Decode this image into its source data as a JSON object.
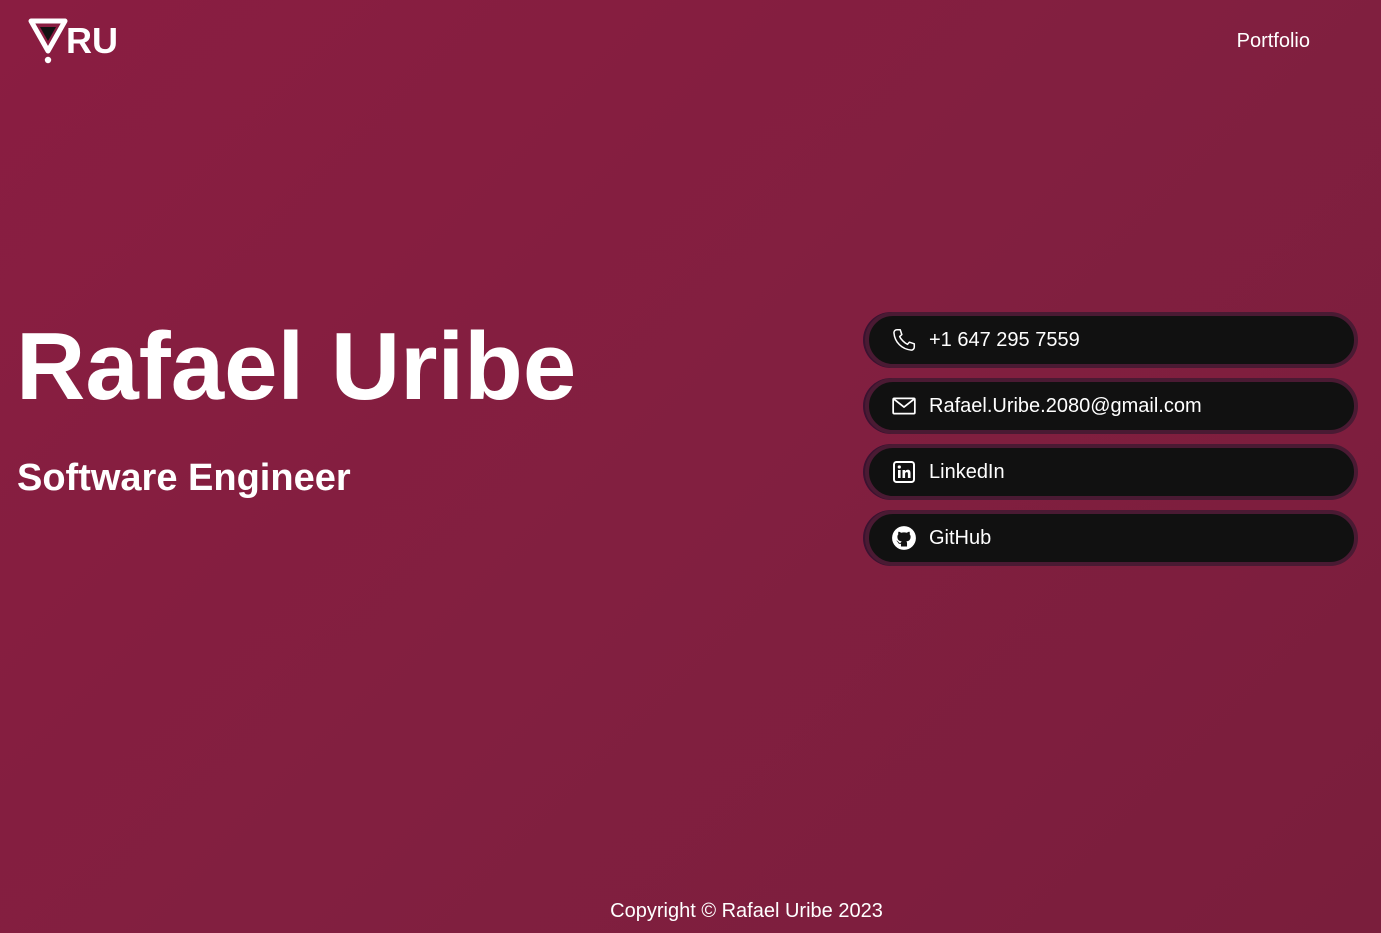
{
  "header": {
    "logo_text": "RU",
    "nav": {
      "portfolio_label": "Portfolio"
    }
  },
  "hero": {
    "name": "Rafael Uribe",
    "role": "Software Engineer"
  },
  "contacts": [
    {
      "label": "+1 647 295 7559",
      "icon": "phone-icon"
    },
    {
      "label": "Rafael.Uribe.2080@gmail.com",
      "icon": "mail-icon"
    },
    {
      "label": "LinkedIn",
      "icon": "linkedin-icon"
    },
    {
      "label": "GitHub",
      "icon": "github-icon"
    }
  ],
  "footer": {
    "copyright": "Copyright © Rafael Uribe 2023"
  },
  "colors": {
    "background": "#861e40",
    "button_background": "#111111",
    "button_border": "#4a1a33",
    "text": "#ffffff"
  }
}
